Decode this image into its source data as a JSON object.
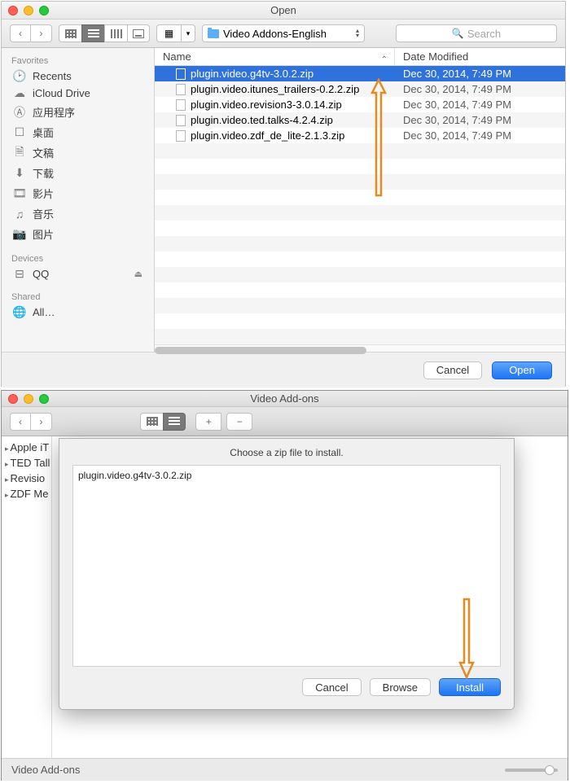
{
  "win1": {
    "title": "Open",
    "path_label": "Video Addons-English",
    "search_placeholder": "Search",
    "sidebar": {
      "favorites_header": "Favorites",
      "items": [
        {
          "icon": "clock",
          "label": "Recents"
        },
        {
          "icon": "cloud",
          "label": "iCloud Drive"
        },
        {
          "icon": "apps",
          "label": "应用程序"
        },
        {
          "icon": "desktop",
          "label": "桌面"
        },
        {
          "icon": "doc",
          "label": "文稿"
        },
        {
          "icon": "down",
          "label": "下载"
        },
        {
          "icon": "movie",
          "label": "影片"
        },
        {
          "icon": "music",
          "label": "音乐"
        },
        {
          "icon": "photo",
          "label": "图片"
        }
      ],
      "devices_header": "Devices",
      "devices": [
        {
          "label": "QQ"
        }
      ],
      "shared_header": "Shared",
      "shared": [
        {
          "label": "All…"
        }
      ]
    },
    "columns": {
      "name": "Name",
      "date": "Date Modified"
    },
    "files": [
      {
        "name": "plugin.video.g4tv-3.0.2.zip",
        "date": "Dec 30, 2014, 7:49 PM",
        "selected": true
      },
      {
        "name": "plugin.video.itunes_trailers-0.2.2.zip",
        "date": "Dec 30, 2014, 7:49 PM"
      },
      {
        "name": "plugin.video.revision3-3.0.14.zip",
        "date": "Dec 30, 2014, 7:49 PM"
      },
      {
        "name": "plugin.video.ted.talks-4.2.4.zip",
        "date": "Dec 30, 2014, 7:49 PM"
      },
      {
        "name": "plugin.video.zdf_de_lite-2.1.3.zip",
        "date": "Dec 30, 2014, 7:49 PM"
      }
    ],
    "cancel": "Cancel",
    "open": "Open"
  },
  "win2": {
    "title": "Video Add-ons",
    "leftlist": [
      "Apple iT",
      "TED Tall",
      "Revisio",
      "ZDF Me"
    ],
    "modal": {
      "title": "Choose a zip file to install.",
      "file": "plugin.video.g4tv-3.0.2.zip",
      "cancel": "Cancel",
      "browse": "Browse",
      "install": "Install"
    },
    "status": "Video Add-ons"
  },
  "colors": {
    "accent": "#1d74f5",
    "arrow": "#e58a1f"
  }
}
